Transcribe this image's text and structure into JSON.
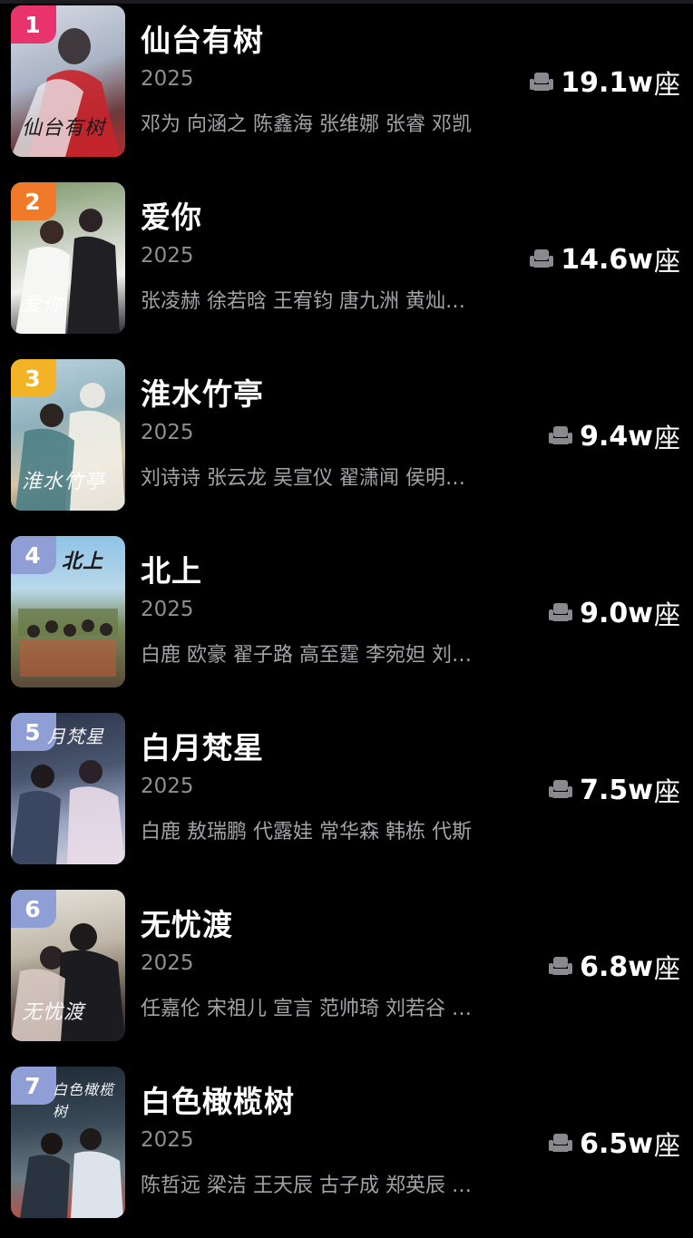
{
  "colors": {
    "background": "#000000",
    "title": "#ffffff",
    "year": "#8e8e93",
    "cast": "#a3a3a8",
    "rank_1": "#e8336d",
    "rank_2": "#f07a2a",
    "rank_3": "#f2b327",
    "rank_other": "#8f9fd6"
  },
  "seat_icon": "seat-icon",
  "dramas": [
    {
      "rank": "1",
      "title": "仙台有树",
      "year": "2025",
      "cast": "邓为 向涵之 陈鑫海 张维娜 张睿 邓凯",
      "heat": "19.1w",
      "unit": "座",
      "badge_color": "#e8336d",
      "poster_text": "仙台有树"
    },
    {
      "rank": "2",
      "title": "爱你",
      "year": "2025",
      "cast": "张凌赫 徐若晗 王宥钧 唐九洲 黄灿…",
      "heat": "14.6w",
      "unit": "座",
      "badge_color": "#f07a2a",
      "poster_text": "爱你"
    },
    {
      "rank": "3",
      "title": "淮水竹亭",
      "year": "2025",
      "cast": "刘诗诗 张云龙 吴宣仪 翟潇闻 侯明…",
      "heat": "9.4w",
      "unit": "座",
      "badge_color": "#f2b327",
      "poster_text": "淮水竹亭"
    },
    {
      "rank": "4",
      "title": "北上",
      "year": "2025",
      "cast": "白鹿 欧豪 翟子路 高至霆 李宛妲 刘…",
      "heat": "9.0w",
      "unit": "座",
      "badge_color": "#8f9fd6",
      "poster_text": "北上"
    },
    {
      "rank": "5",
      "title": "白月梵星",
      "year": "2025",
      "cast": "白鹿 敖瑞鹏 代露娃 常华森 韩栋 代斯",
      "heat": "7.5w",
      "unit": "座",
      "badge_color": "#8f9fd6",
      "poster_text": "月梵星"
    },
    {
      "rank": "6",
      "title": "无忧渡",
      "year": "2025",
      "cast": "任嘉伦 宋祖儿 宣言 范帅琦 刘若谷 …",
      "heat": "6.8w",
      "unit": "座",
      "badge_color": "#8f9fd6",
      "poster_text": "无忧渡"
    },
    {
      "rank": "7",
      "title": "白色橄榄树",
      "year": "2025",
      "cast": "陈哲远 梁洁 王天辰 古子成 郑英辰 …",
      "heat": "6.5w",
      "unit": "座",
      "badge_color": "#8f9fd6",
      "poster_text": "白色橄榄树"
    }
  ]
}
